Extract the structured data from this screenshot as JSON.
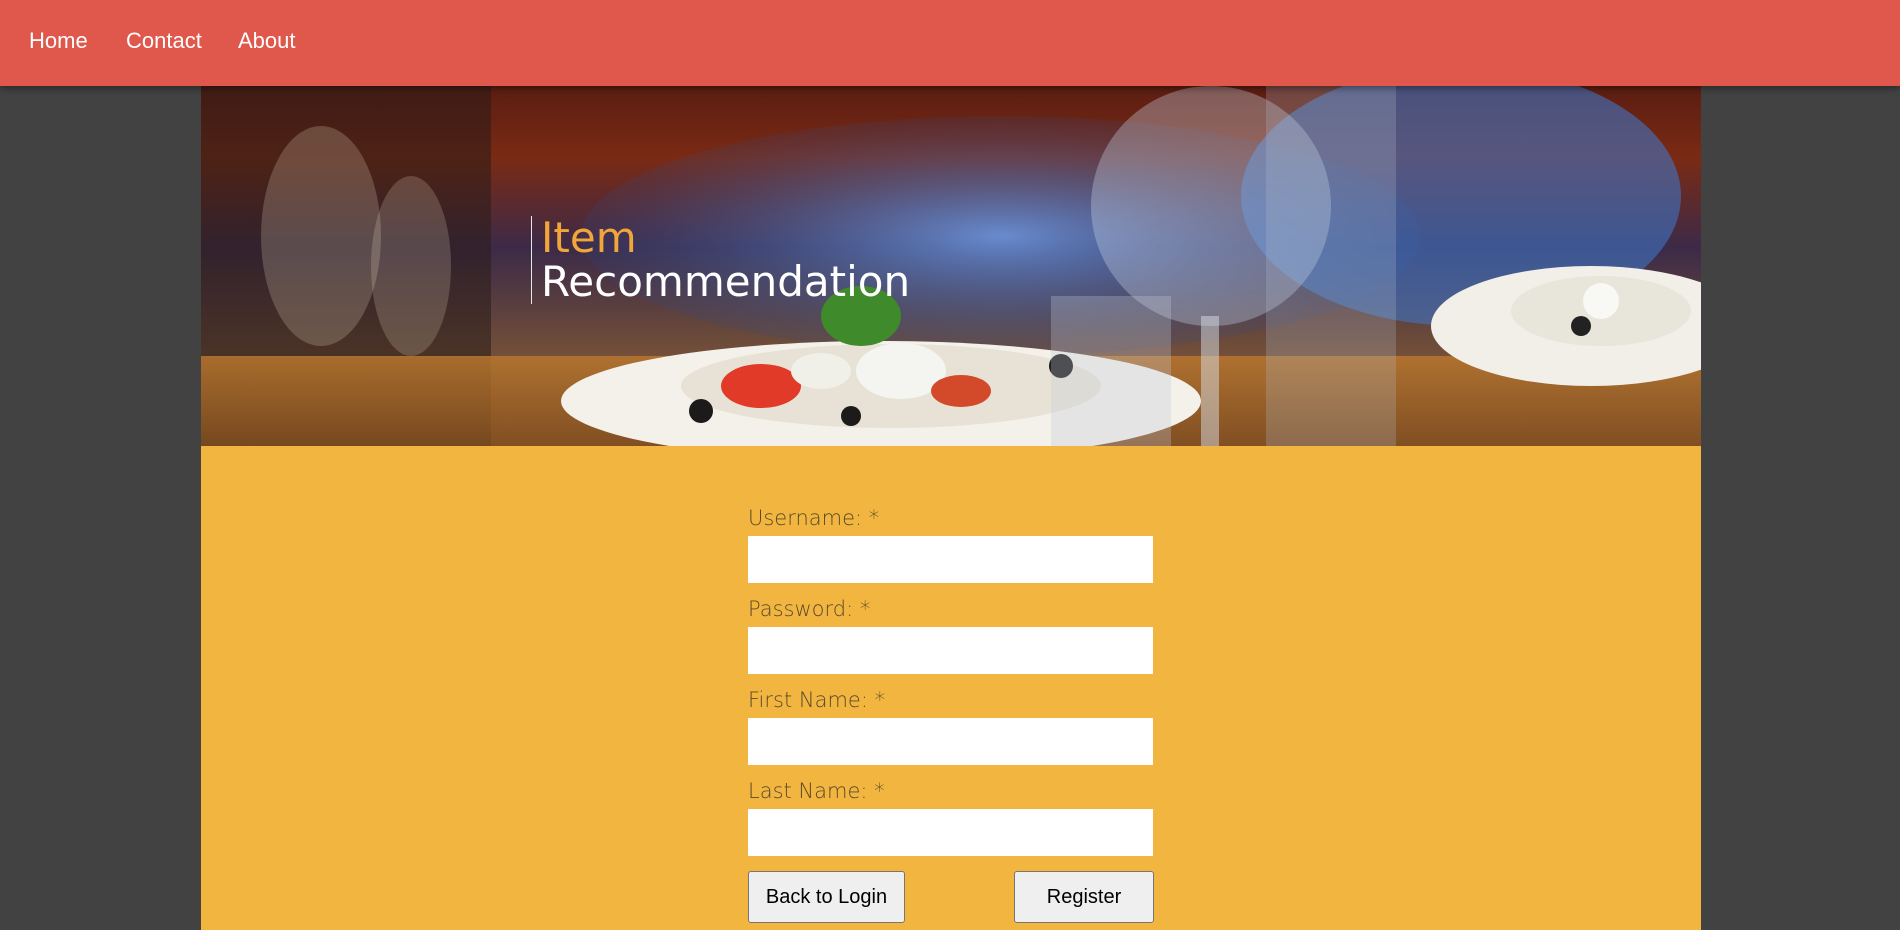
{
  "nav": {
    "links": [
      {
        "label": "Home"
      },
      {
        "label": "Contact"
      },
      {
        "label": "About"
      }
    ]
  },
  "header": {
    "title_line1": "Item",
    "title_line2": "Recommendation"
  },
  "form": {
    "fields": [
      {
        "label": "Username: *",
        "value": "",
        "placeholder": ""
      },
      {
        "label": "Password: *",
        "value": "",
        "placeholder": ""
      },
      {
        "label": "First Name: *",
        "value": "",
        "placeholder": ""
      },
      {
        "label": "Last Name: *",
        "value": "",
        "placeholder": ""
      }
    ],
    "back_label": "Back to Login",
    "register_label": "Register"
  },
  "colors": {
    "nav_bg": "#e0574c",
    "page_bg": "#424242",
    "form_bg": "#f2b640",
    "title_accent": "#f2a63a"
  }
}
